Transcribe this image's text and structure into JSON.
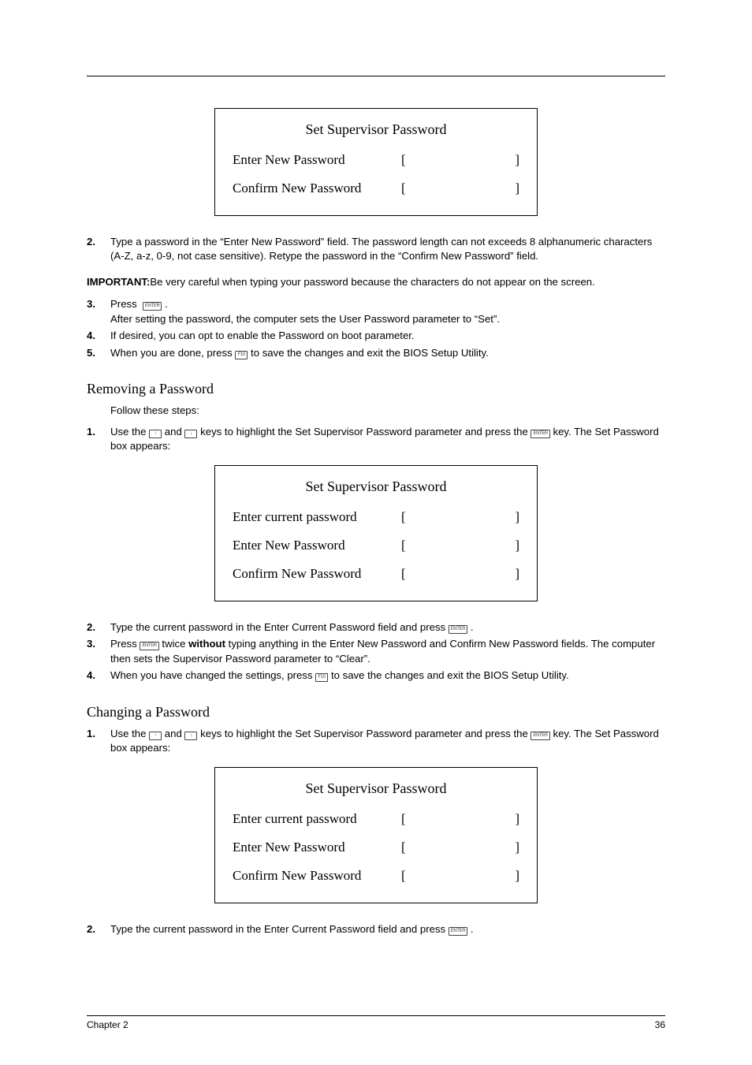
{
  "dialogs": {
    "set": {
      "title": "Set Supervisor Password",
      "enter_new": "Enter New Password",
      "confirm_new": "Confirm New Password"
    },
    "remove": {
      "title": "Set Supervisor Password",
      "enter_current": "Enter current password",
      "enter_new": "Enter New Password",
      "confirm_new": "Confirm New Password"
    },
    "change": {
      "title": "Set Supervisor Password",
      "enter_current": "Enter current password",
      "enter_new": "Enter New Password",
      "confirm_new": "Confirm New Password"
    }
  },
  "steps_top": {
    "s2": "Type a password in the “Enter New Password” field. The password length can not exceeds 8 alphanumeric characters (A-Z, a-z, 0-9, not case sensitive). Retype the password in the “Confirm New Password” field.",
    "s3a": "Press",
    "s3b": ".",
    "s3c": "After setting the password, the computer sets the User Password parameter to “Set”.",
    "s4": "If desired, you can opt to enable the Password on boot parameter.",
    "s5a": "When you are done, press",
    "s5b": "to save the changes and exit the BIOS Setup Utility."
  },
  "important": {
    "label": "IMPORTANT:",
    "text": "Be very careful when typing your password because the characters do not appear on the screen."
  },
  "sections": {
    "removing": "Removing a Password",
    "changing": "Changing a Password"
  },
  "removing": {
    "intro": "Follow these steps:",
    "s1a": "Use the",
    "s1b": "and",
    "s1c": "keys to highlight the Set Supervisor Password parameter and press the",
    "s1d": "key. The Set Password box appears:",
    "s2a": "Type the current password in the Enter Current Password field and press",
    "s2b": ".",
    "s3a": "Press",
    "s3b": "twice",
    "s3c": "without",
    "s3d": "typing anything in the Enter New Password and Confirm New Password fields. The computer then sets the Supervisor Password parameter to “Clear”.",
    "s4a": "When you have changed the settings, press",
    "s4b": "to save the changes and exit the BIOS Setup Utility."
  },
  "changing": {
    "s1a": "Use the",
    "s1b": "and",
    "s1c": "keys to highlight the Set Supervisor Password parameter and press the",
    "s1d": "key. The Set Password box appears:",
    "s2a": "Type the current password in the Enter Current Password field and press",
    "s2b": "."
  },
  "keys": {
    "enter": "ENTER",
    "f10": "F10",
    "up": "↑",
    "down": "↓"
  },
  "footer": {
    "left": "Chapter 2",
    "right": "36"
  },
  "nums": {
    "n1": "1.",
    "n2": "2.",
    "n3": "3.",
    "n4": "4.",
    "n5": "5."
  }
}
